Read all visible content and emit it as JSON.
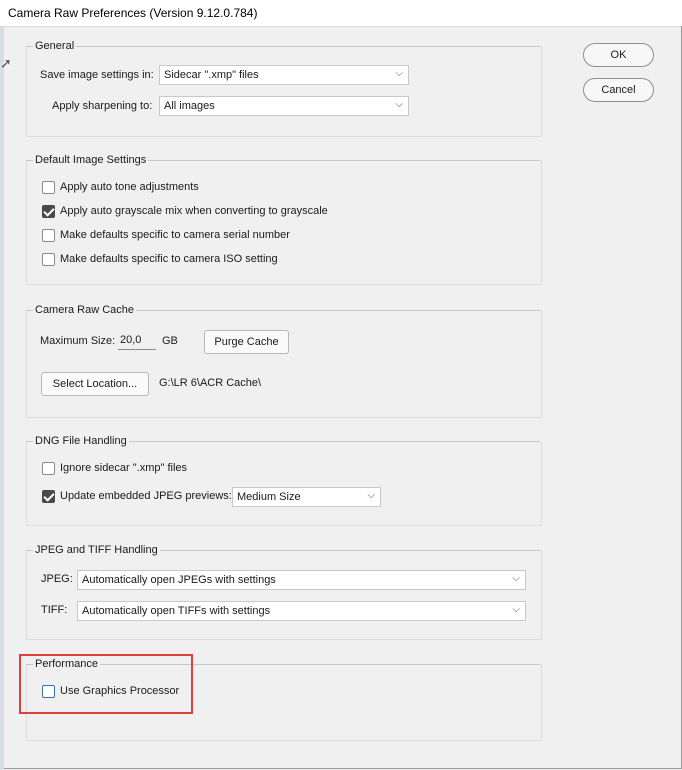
{
  "window": {
    "title": "Camera Raw Preferences  (Version 9.12.0.784)"
  },
  "buttons": {
    "ok": "OK",
    "cancel": "Cancel"
  },
  "general": {
    "title": "General",
    "save_label": "Save image settings in:",
    "save_value": "Sidecar \".xmp\" files",
    "sharpen_label": "Apply sharpening to:",
    "sharpen_value": "All images"
  },
  "default_image": {
    "title": "Default Image Settings",
    "options": [
      {
        "label": "Apply auto tone adjustments",
        "checked": false
      },
      {
        "label": "Apply auto grayscale mix when converting to grayscale",
        "checked": true
      },
      {
        "label": "Make defaults specific to camera serial number",
        "checked": false
      },
      {
        "label": "Make defaults specific to camera ISO setting",
        "checked": false
      }
    ]
  },
  "cache": {
    "title": "Camera Raw Cache",
    "max_size_label": "Maximum Size:",
    "max_size_value": "20,0",
    "unit": "GB",
    "purge_label": "Purge Cache",
    "select_location_label": "Select Location...",
    "location_path": "G:\\LR 6\\ACR Cache\\"
  },
  "dng": {
    "title": "DNG File Handling",
    "ignore_label": "Ignore sidecar \".xmp\" files",
    "ignore_checked": false,
    "update_label": "Update embedded JPEG previews:",
    "update_checked": true,
    "preview_size": "Medium Size"
  },
  "jpeg_tiff": {
    "title": "JPEG and TIFF Handling",
    "jpeg_label": "JPEG:",
    "jpeg_value": "Automatically open JPEGs with settings",
    "tiff_label": "TIFF:",
    "tiff_value": "Automatically open TIFFs with settings"
  },
  "performance": {
    "title": "Performance",
    "gpu_label": "Use Graphics Processor",
    "gpu_checked": false
  },
  "colors": {
    "highlight": "#e0403a",
    "checkbox_checked": "#4a4a4a"
  }
}
